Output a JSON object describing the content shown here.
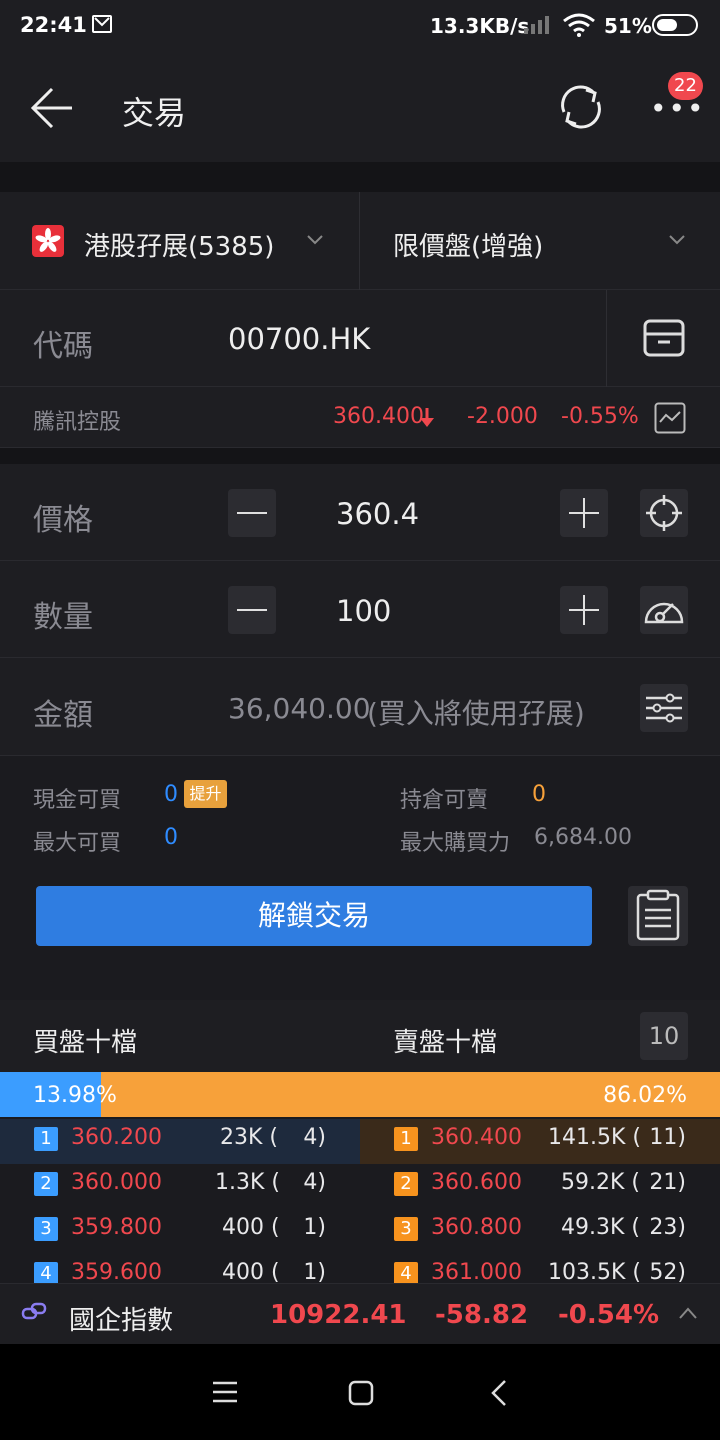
{
  "status": {
    "time": "22:41",
    "speed": "13.3KB/s",
    "battery": "51%"
  },
  "header": {
    "title": "交易",
    "badge_count": "22"
  },
  "account": {
    "name": "港股孖展(5385)",
    "order_type": "限價盤(增強)"
  },
  "code": {
    "label": "代碼",
    "value": "00700.HK"
  },
  "quote": {
    "name": "騰訊控股",
    "price": "360.400",
    "change": "-2.000",
    "change_pct": "-0.55%"
  },
  "price": {
    "label": "價格",
    "value": "360.4"
  },
  "quantity": {
    "label": "數量",
    "value": "100"
  },
  "amount": {
    "label": "金額",
    "value": "36,040.00",
    "note": "(買入將使用孖展)"
  },
  "buying": {
    "cash_buy_label": "現金可買",
    "cash_buy_value": "0",
    "upgrade_label": "提升",
    "hold_sell_label": "持倉可賣",
    "hold_sell_value": "0",
    "max_buy_label": "最大可買",
    "max_buy_value": "0",
    "max_power_label": "最大購買力",
    "max_power_value": "6,684.00"
  },
  "unlock_button": "解鎖交易",
  "orderbook": {
    "bid_title": "買盤十檔",
    "ask_title": "賣盤十檔",
    "depth_label": "10",
    "bid_pct": "13.98%",
    "ask_pct": "86.02%",
    "bid_ratio": 0.1398,
    "bids": [
      {
        "idx": "1",
        "price": "360.200",
        "vol": "23K (",
        "count": "4)"
      },
      {
        "idx": "2",
        "price": "360.000",
        "vol": "1.3K (",
        "count": "4)"
      },
      {
        "idx": "3",
        "price": "359.800",
        "vol": "400 (",
        "count": "1)"
      },
      {
        "idx": "4",
        "price": "359.600",
        "vol": "400 (",
        "count": "1)"
      }
    ],
    "asks": [
      {
        "idx": "1",
        "price": "360.400",
        "vol": "141.5K (",
        "count": "11)"
      },
      {
        "idx": "2",
        "price": "360.600",
        "vol": "59.2K (",
        "count": "21)"
      },
      {
        "idx": "3",
        "price": "360.800",
        "vol": "49.3K (",
        "count": "23)"
      },
      {
        "idx": "4",
        "price": "361.000",
        "vol": "103.5K (",
        "count": "52)"
      }
    ]
  },
  "ticker": {
    "name": "國企指數",
    "value": "10922.41",
    "change": "-58.82",
    "change_pct": "-0.54%"
  },
  "colors": {
    "bid": "#3b9dff",
    "ask": "#f7a13a",
    "down": "#f0484e",
    "button": "#2f7de1"
  }
}
